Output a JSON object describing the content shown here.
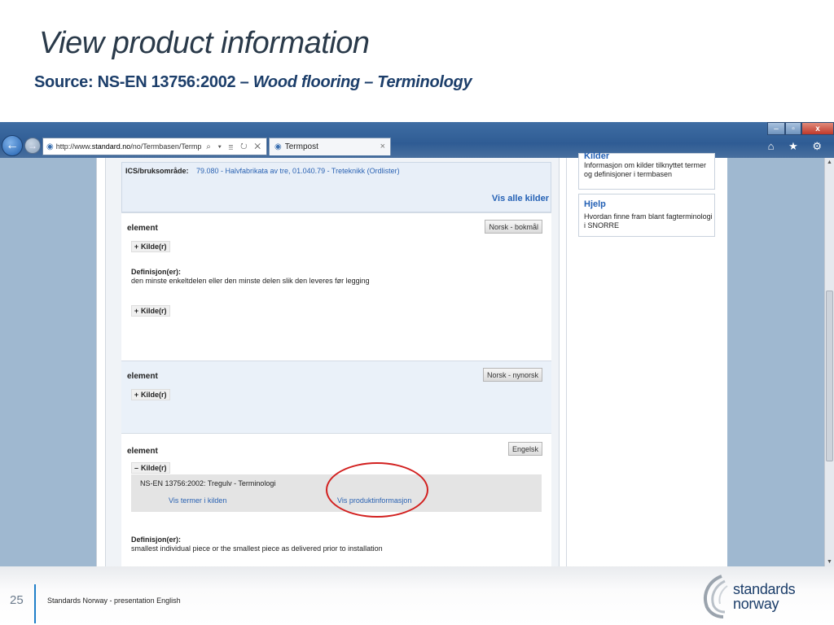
{
  "slide": {
    "title": "View product information",
    "subtitle_prefix": "Source: NS-EN 13756:2002 –",
    "subtitle_italic": "Wood flooring – Terminology",
    "number": "25",
    "footer_text": "Standards Norway - presentation English",
    "logo_line1": "standards",
    "logo_line2": "norway"
  },
  "browser": {
    "back_icon": "back-arrow-icon",
    "forward_icon": "forward-arrow-icon",
    "address_prefix": "http://www.",
    "address_domain": "standard.no",
    "address_rest": "/no/Termbasen/Termp",
    "address_tools": "⌕ ▾ ≣ ↻ ✕",
    "tab_title": "Termpost",
    "tab_close": "×",
    "window_min": "–",
    "window_max": "▫",
    "window_close": "x",
    "right_tools": "⌂ ★ ⚙"
  },
  "page": {
    "ics_label": "ICS/bruksområde:",
    "ics_value": "79.080 - Halvfabrikata av tre, 01.040.79 - Treteknikk (Ordlister)",
    "vis_alle": "Vis alle kilder",
    "terms": [
      {
        "term": "element",
        "language": "Norsk - bokmål",
        "kilde_top": "Kilde(r)",
        "definition_label": "Definisjon(er):",
        "definition": "den minste enkeltdelen eller den minste delen slik den leveres før legging",
        "kilde_bottom": "Kilde(r)"
      },
      {
        "term": "element",
        "language": "Norsk - nynorsk",
        "kilde_top": "Kilde(r)"
      },
      {
        "term": "element",
        "language": "Engelsk",
        "kilde_top": "Kilde(r)",
        "source_title": "NS-EN 13756:2002: Tregulv - Terminologi",
        "source_link1": "Vis termer i kilden",
        "source_link2": "Vis produktinformasjon",
        "definition_label": "Definisjon(er):",
        "definition": "smallest individual piece or the smallest piece as delivered prior to installation"
      }
    ],
    "expand_symbol": "+",
    "collapse_symbol": "–"
  },
  "sidebar": {
    "kilder_head": "Kilder",
    "kilder_text": "Informasjon om kilder tilknyttet termer og definisjoner i termbasen",
    "hjelp_head": "Hjelp",
    "hjelp_text": "Hvordan finne fram blant fagterminologi i SNORRE"
  },
  "colors": {
    "title": "#2a3a4a",
    "subtitle": "#1c3e6a",
    "link": "#2b63b3",
    "highlight": "#d2201f",
    "accent": "#1f7fc9"
  }
}
